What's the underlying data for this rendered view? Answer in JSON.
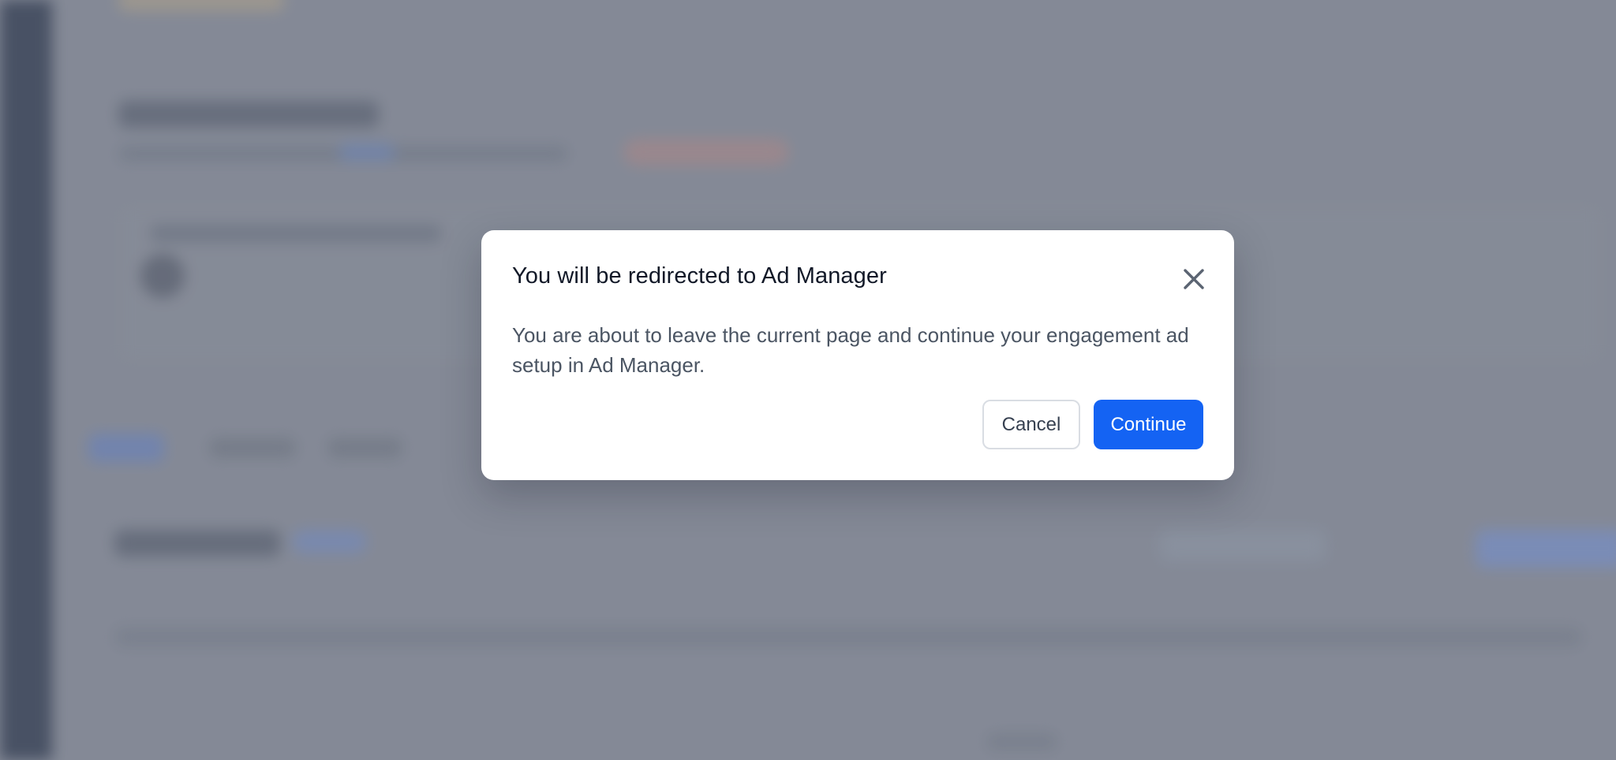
{
  "dialog": {
    "title": "You will be redirected to Ad Manager",
    "message": "You are about to leave the current page and continue your engagement ad setup in Ad Manager.",
    "close_icon": "close-icon",
    "cancel_label": "Cancel",
    "continue_label": "Continue"
  },
  "colors": {
    "primary": "#1463f3",
    "overlay": "#8b909c",
    "sidebar": "#2f3a4f"
  }
}
